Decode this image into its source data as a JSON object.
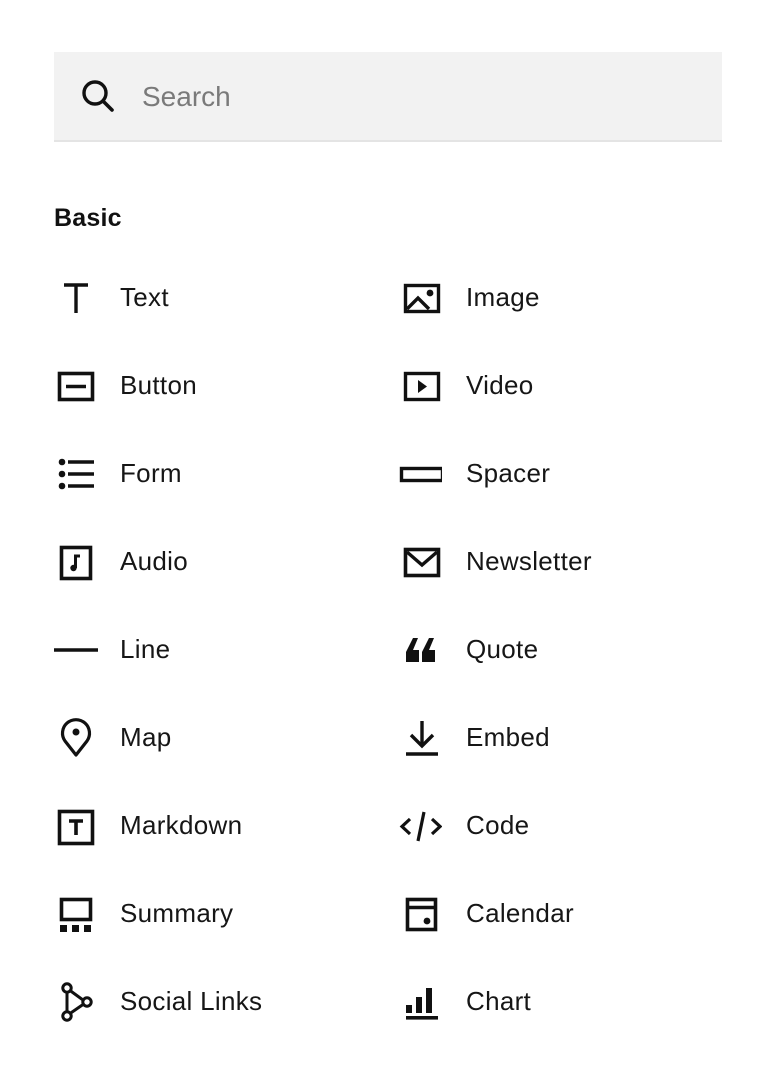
{
  "search": {
    "placeholder": "Search",
    "value": "",
    "icon": "search-icon"
  },
  "section": {
    "title": "Basic"
  },
  "blocks": [
    {
      "label": "Text",
      "icon": "text-icon"
    },
    {
      "label": "Image",
      "icon": "image-icon"
    },
    {
      "label": "Button",
      "icon": "button-icon"
    },
    {
      "label": "Video",
      "icon": "video-icon"
    },
    {
      "label": "Form",
      "icon": "form-icon"
    },
    {
      "label": "Spacer",
      "icon": "spacer-icon"
    },
    {
      "label": "Audio",
      "icon": "audio-icon"
    },
    {
      "label": "Newsletter",
      "icon": "newsletter-icon"
    },
    {
      "label": "Line",
      "icon": "line-icon"
    },
    {
      "label": "Quote",
      "icon": "quote-icon"
    },
    {
      "label": "Map",
      "icon": "map-pin-icon"
    },
    {
      "label": "Embed",
      "icon": "embed-icon"
    },
    {
      "label": "Markdown",
      "icon": "markdown-icon"
    },
    {
      "label": "Code",
      "icon": "code-icon"
    },
    {
      "label": "Summary",
      "icon": "summary-icon"
    },
    {
      "label": "Calendar",
      "icon": "calendar-icon"
    },
    {
      "label": "Social Links",
      "icon": "social-links-icon"
    },
    {
      "label": "Chart",
      "icon": "chart-icon"
    }
  ]
}
